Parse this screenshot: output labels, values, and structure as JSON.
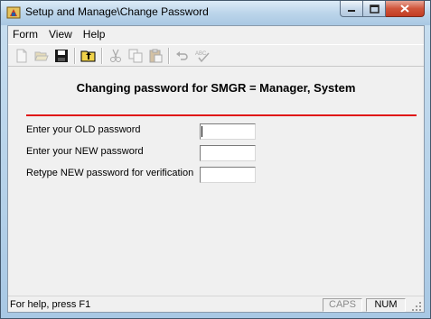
{
  "window": {
    "title": "Setup and Manage\\Change Password"
  },
  "menu": [
    {
      "label": "Form"
    },
    {
      "label": "View"
    },
    {
      "label": "Help"
    }
  ],
  "toolbar": {
    "buttons": [
      {
        "icon": "new-document-icon",
        "enabled": false
      },
      {
        "icon": "open-folder-icon",
        "enabled": false
      },
      {
        "icon": "save-icon",
        "enabled": true
      },
      {
        "icon": "up-folder-icon",
        "enabled": true
      },
      {
        "icon": "cut-icon",
        "enabled": false
      },
      {
        "icon": "copy-icon",
        "enabled": false
      },
      {
        "icon": "paste-icon",
        "enabled": false
      },
      {
        "icon": "undo-icon",
        "enabled": false
      },
      {
        "icon": "spellcheck-icon",
        "enabled": false
      }
    ]
  },
  "form": {
    "heading": "Changing password for SMGR = Manager, System",
    "old_label": "Enter your OLD password",
    "new_label": "Enter your NEW password",
    "retype_label": "Retype NEW password for verification",
    "old_value": "",
    "new_value": "",
    "retype_value": ""
  },
  "status": {
    "help": "For help, press F1",
    "caps": "CAPS",
    "num": "NUM"
  },
  "colors": {
    "divider": "#e01010",
    "close_button": "#c23b22"
  }
}
